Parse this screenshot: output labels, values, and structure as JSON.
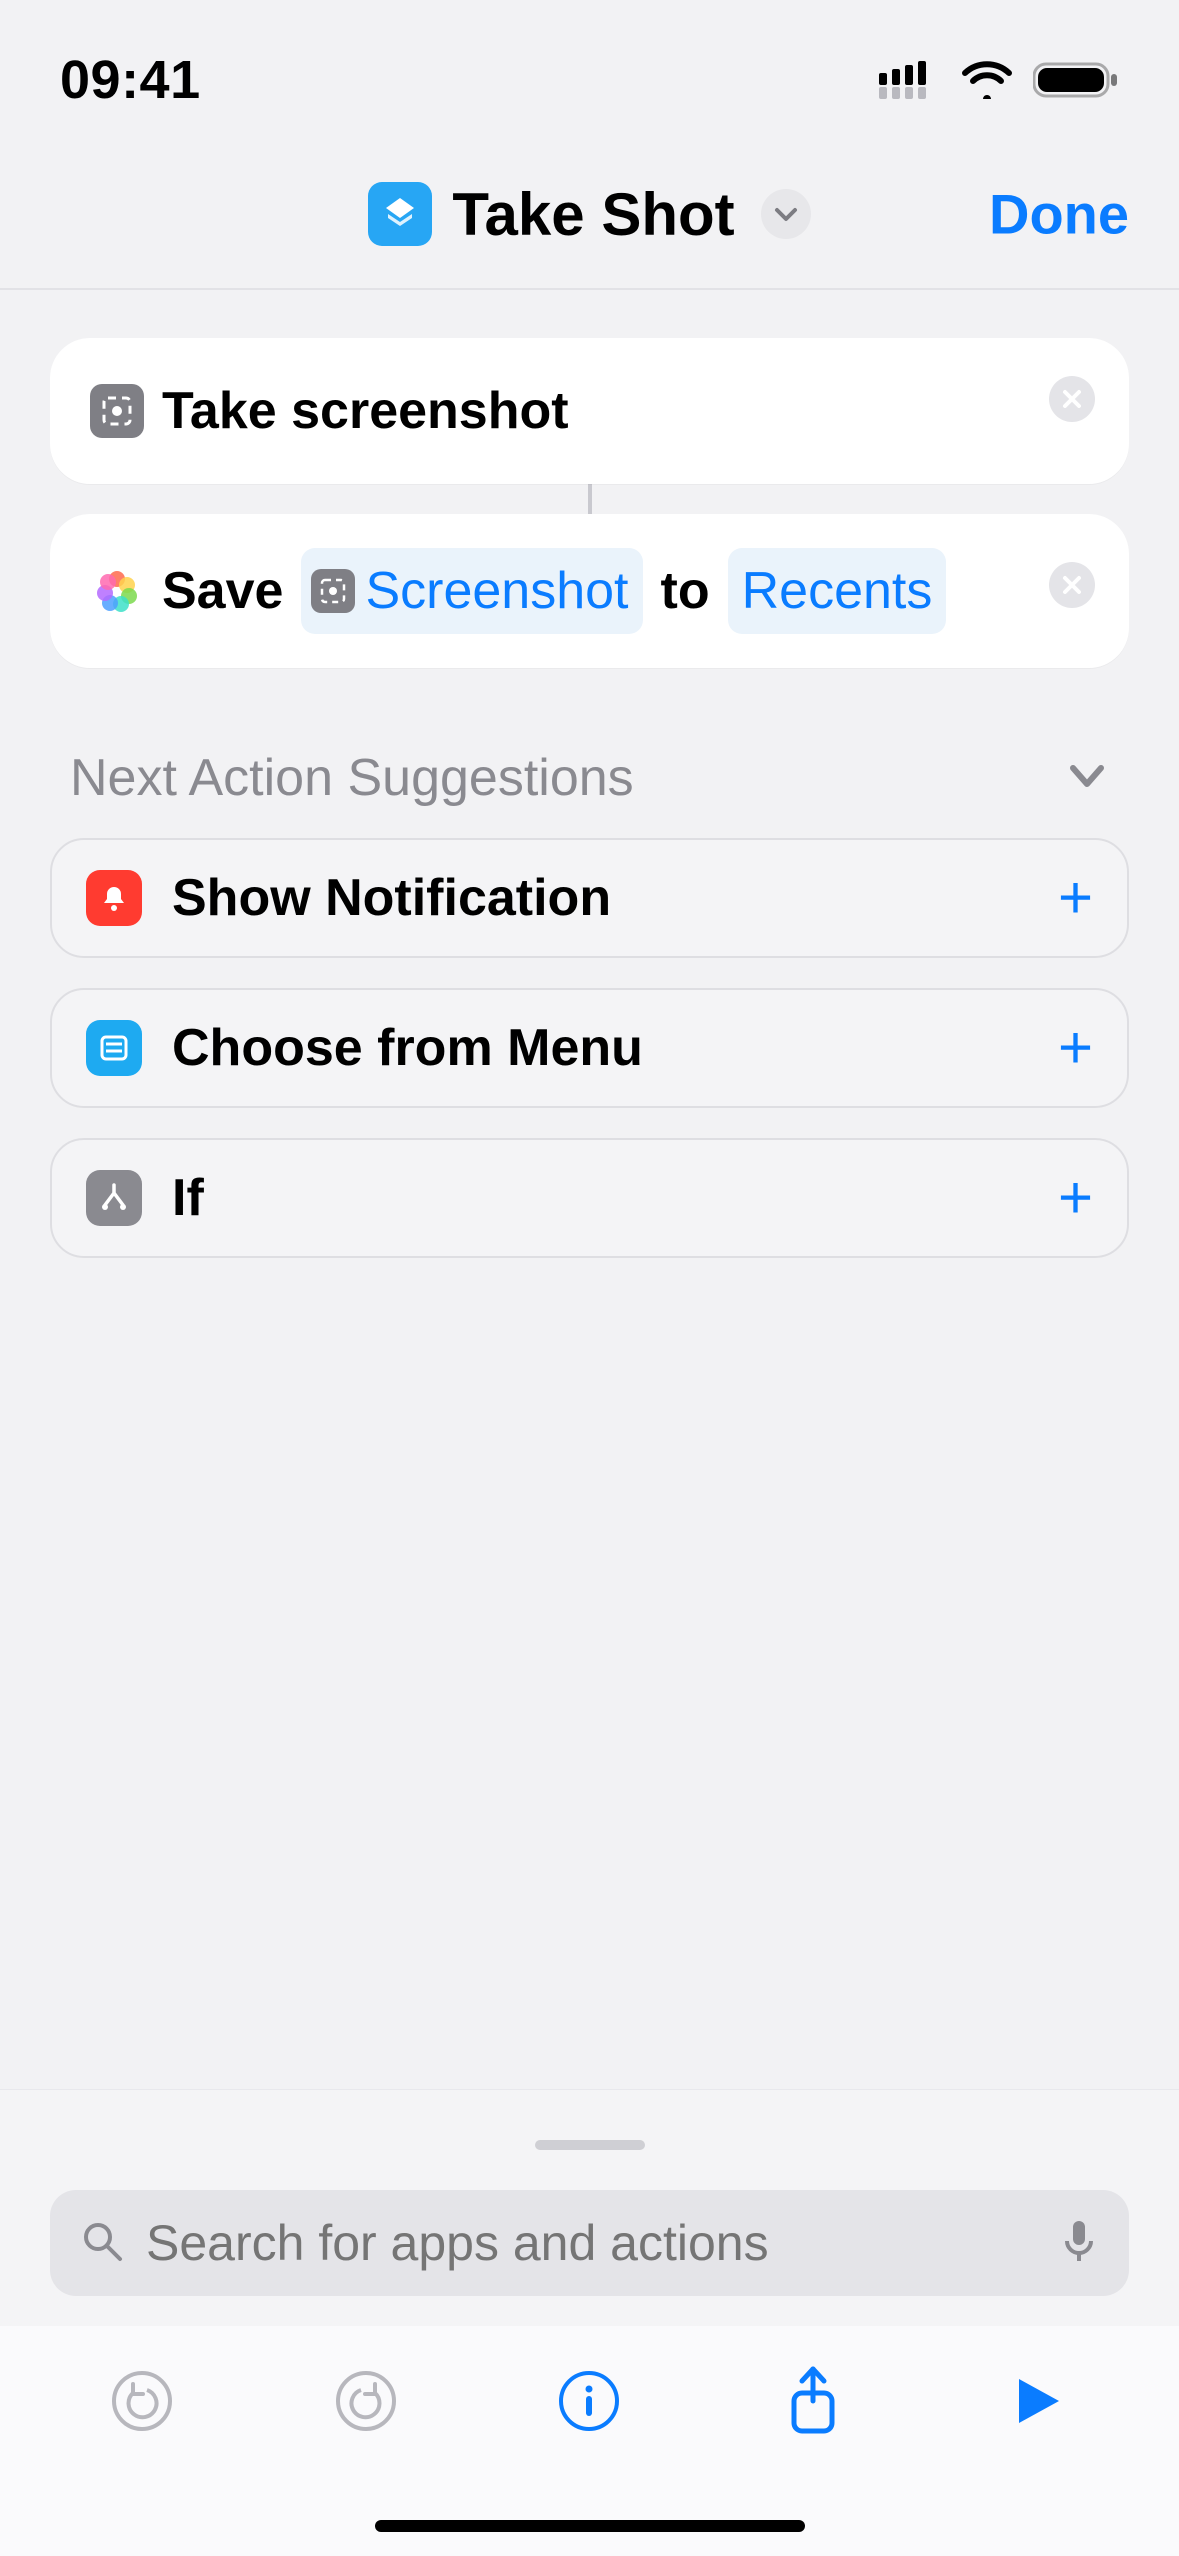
{
  "status": {
    "time": "09:41"
  },
  "nav": {
    "title": "Take Shot",
    "done": "Done"
  },
  "actions": {
    "a1": {
      "title": "Take screenshot"
    },
    "a2": {
      "verb": "Save",
      "variable": "Screenshot",
      "preposition": "to",
      "target": "Recents"
    }
  },
  "suggestions": {
    "header": "Next Action Suggestions",
    "items": {
      "s1": {
        "label": "Show Notification"
      },
      "s2": {
        "label": "Choose from Menu"
      },
      "s3": {
        "label": "If"
      }
    }
  },
  "search": {
    "placeholder": "Search for apps and actions"
  }
}
